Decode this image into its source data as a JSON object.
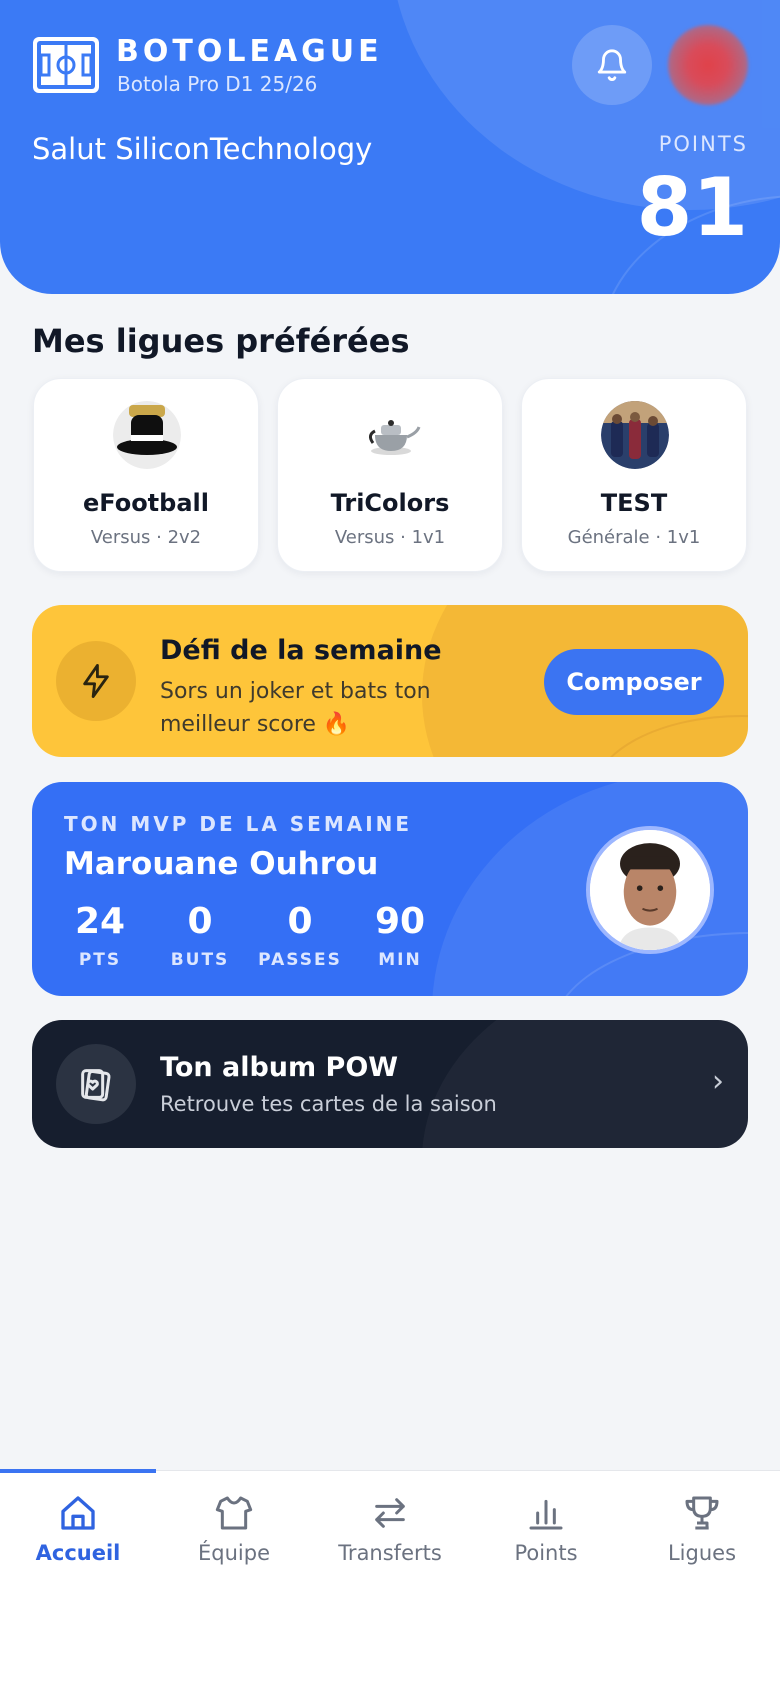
{
  "app": {
    "brand": "BOTOLEAGUE",
    "season": "Botola Pro D1 25/26",
    "greeting": "Salut SiliconTechnology",
    "points_label": "POINTS",
    "points_value": "81",
    "accent": "#3b7af5"
  },
  "favorites": {
    "title": "Mes ligues préférées",
    "leagues": [
      {
        "name": "eFootball",
        "meta": "Versus · 2v2",
        "icon": "hat-avatar-icon"
      },
      {
        "name": "TriColors",
        "meta": "Versus · 1v1",
        "icon": "teapot-icon"
      },
      {
        "name": "TEST",
        "meta": "Générale · 1v1",
        "icon": "france-team-avatar-icon"
      }
    ]
  },
  "challenge": {
    "title": "Défi de la semaine",
    "description": "Sors un joker et bats ton meilleur score 🔥",
    "button": "Composer",
    "color": "#fec53a"
  },
  "mvp": {
    "label": "TON MVP DE LA SEMAINE",
    "name": "Marouane Ouhrou",
    "stats": [
      {
        "value": "24",
        "label": "PTS"
      },
      {
        "value": "0",
        "label": "BUTS"
      },
      {
        "value": "0",
        "label": "PASSES"
      },
      {
        "value": "90",
        "label": "MIN"
      }
    ]
  },
  "album": {
    "title": "Ton album POW",
    "subtitle": "Retrouve tes cartes de la saison",
    "chevron": "›"
  },
  "nav": {
    "active": "Accueil",
    "items": [
      {
        "label": "Accueil",
        "icon": "home-icon"
      },
      {
        "label": "Équipe",
        "icon": "shirt-icon"
      },
      {
        "label": "Transferts",
        "icon": "transfer-arrows-icon"
      },
      {
        "label": "Points",
        "icon": "bar-chart-icon"
      },
      {
        "label": "Ligues",
        "icon": "trophy-icon"
      }
    ]
  }
}
